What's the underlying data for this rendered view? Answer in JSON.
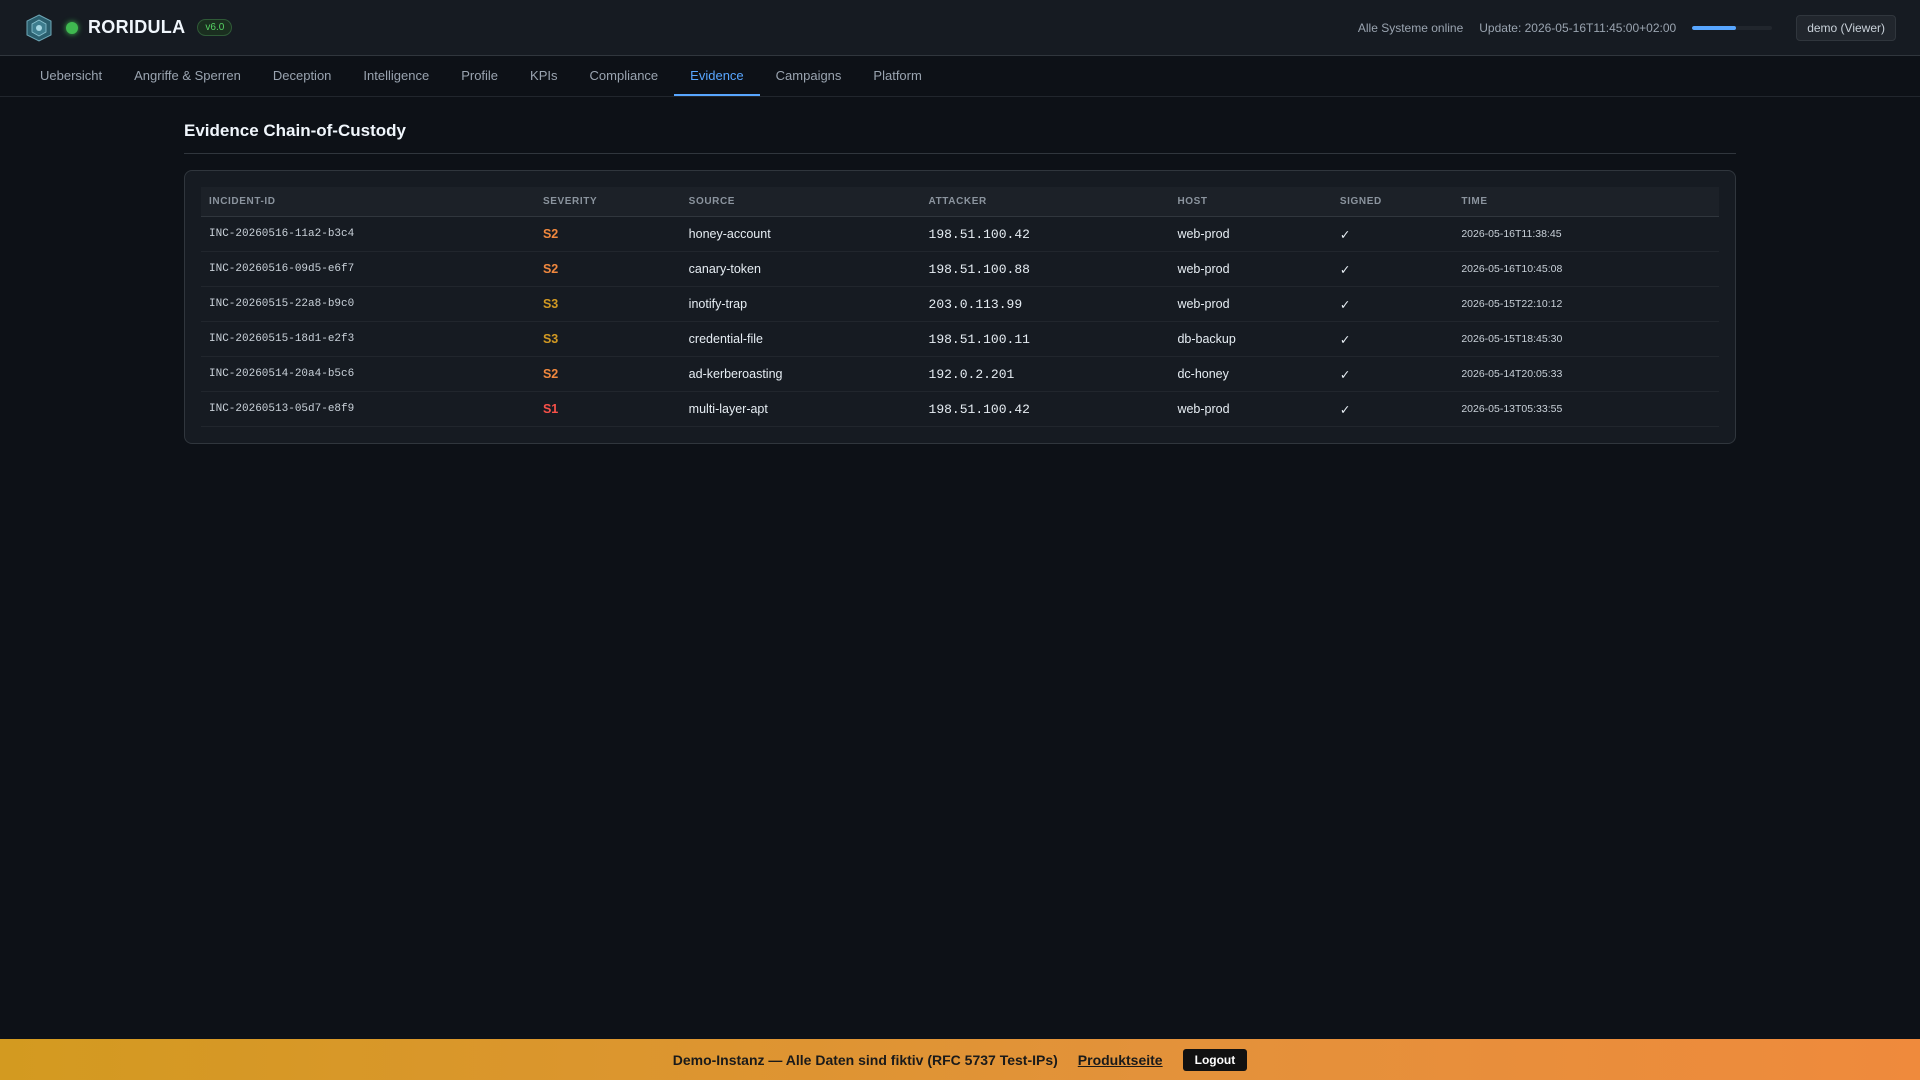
{
  "header": {
    "app_title": "RORIDULA",
    "version": "v6.0",
    "system_status": "Alle Systeme online",
    "update_text": "Update: 2026-05-16T11:45:00+02:00",
    "refresh_progress": 0.55,
    "user_label": "demo (Viewer)"
  },
  "nav": {
    "tabs": [
      {
        "label": "Uebersicht"
      },
      {
        "label": "Angriffe & Sperren"
      },
      {
        "label": "Deception"
      },
      {
        "label": "Intelligence"
      },
      {
        "label": "Profile"
      },
      {
        "label": "KPIs"
      },
      {
        "label": "Compliance"
      },
      {
        "label": "Evidence"
      },
      {
        "label": "Campaigns"
      },
      {
        "label": "Platform"
      }
    ],
    "active": "Evidence"
  },
  "page": {
    "title": "Evidence Chain-of-Custody"
  },
  "table": {
    "columns": [
      "INCIDENT-ID",
      "SEVERITY",
      "SOURCE",
      "ATTACKER",
      "HOST",
      "SIGNED",
      "TIME"
    ],
    "rows": [
      {
        "incident_id": "INC-20260516-11a2-b3c4",
        "severity": "S2",
        "source": "honey-account",
        "attacker": "198.51.100.42",
        "host": "web-prod",
        "signed": "✓",
        "time": "2026-05-16T11:38:45"
      },
      {
        "incident_id": "INC-20260516-09d5-e6f7",
        "severity": "S2",
        "source": "canary-token",
        "attacker": "198.51.100.88",
        "host": "web-prod",
        "signed": "✓",
        "time": "2026-05-16T10:45:08"
      },
      {
        "incident_id": "INC-20260515-22a8-b9c0",
        "severity": "S3",
        "source": "inotify-trap",
        "attacker": "203.0.113.99",
        "host": "web-prod",
        "signed": "✓",
        "time": "2026-05-15T22:10:12"
      },
      {
        "incident_id": "INC-20260515-18d1-e2f3",
        "severity": "S3",
        "source": "credential-file",
        "attacker": "198.51.100.11",
        "host": "db-backup",
        "signed": "✓",
        "time": "2026-05-15T18:45:30"
      },
      {
        "incident_id": "INC-20260514-20a4-b5c6",
        "severity": "S2",
        "source": "ad-kerberoasting",
        "attacker": "192.0.2.201",
        "host": "dc-honey",
        "signed": "✓",
        "time": "2026-05-14T20:05:33"
      },
      {
        "incident_id": "INC-20260513-05d7-e8f9",
        "severity": "S1",
        "source": "multi-layer-apt",
        "attacker": "198.51.100.42",
        "host": "web-prod",
        "signed": "✓",
        "time": "2026-05-13T05:33:55"
      }
    ]
  },
  "severity_colors": {
    "S1": "#f85149",
    "S2": "#f0883e",
    "S3": "#d29922"
  },
  "footer": {
    "notice": "Demo-Instanz — Alle Daten sind fiktiv (RFC 5737 Test-IPs)",
    "link_label": "Produktseite",
    "logout_label": "Logout"
  }
}
